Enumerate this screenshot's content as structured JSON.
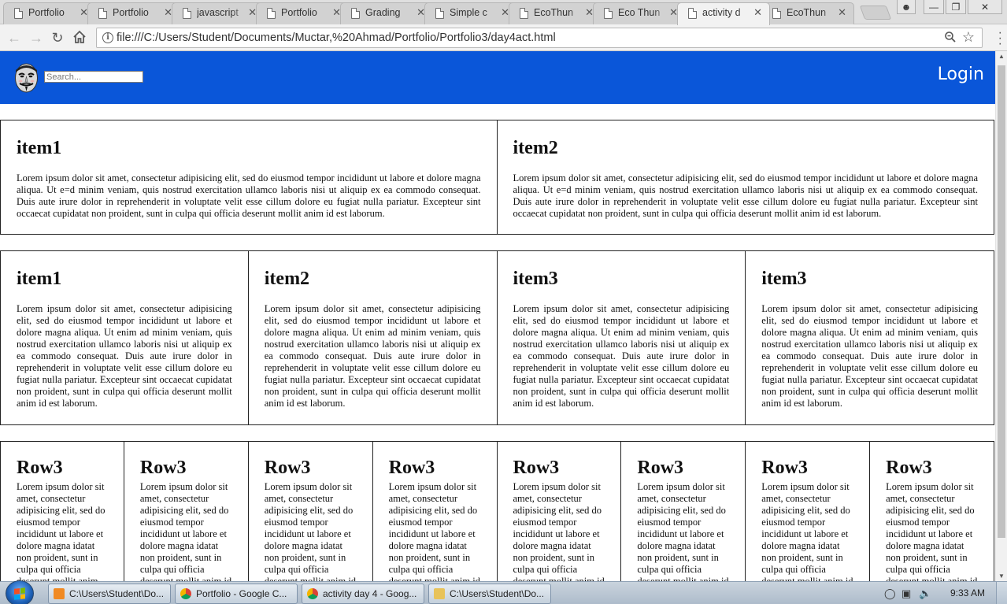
{
  "browser": {
    "tabs": [
      {
        "label": "Portfolio",
        "active": false
      },
      {
        "label": "Portfolio",
        "active": false
      },
      {
        "label": "javascript",
        "active": false
      },
      {
        "label": "Portfolio",
        "active": false
      },
      {
        "label": "Grading",
        "active": false
      },
      {
        "label": "Simple c",
        "active": false
      },
      {
        "label": "EcoThun",
        "active": false
      },
      {
        "label": "Eco Thun",
        "active": false
      },
      {
        "label": "activity d",
        "active": true
      },
      {
        "label": "EcoThun",
        "active": false
      }
    ],
    "tab_close_glyph": "✕",
    "address": "file:///C:/Users/Student/Documents/Muctar,%20Ahmad/Portfolio/Portfolio3/day4act.html"
  },
  "page": {
    "header": {
      "search_placeholder": "Search...",
      "login_label": "Login"
    },
    "row1": [
      {
        "title": "item1",
        "text": "Lorem ipsum dolor sit amet, consectetur adipisicing elit, sed do eiusmod tempor incididunt ut labore et dolore magna aliqua. Ut e=d minim veniam, quis nostrud exercitation ullamco laboris nisi ut aliquip ex ea commodo consequat. Duis aute irure dolor in reprehenderit in voluptate velit esse cillum dolore eu fugiat nulla pariatur. Excepteur sint occaecat cupidatat non proident, sunt in culpa qui officia deserunt mollit anim id est laborum."
      },
      {
        "title": "item2",
        "text": "Lorem ipsum dolor sit amet, consectetur adipisicing elit, sed do eiusmod tempor incididunt ut labore et dolore magna aliqua. Ut e=d minim veniam, quis nostrud exercitation ullamco laboris nisi ut aliquip ex ea commodo consequat. Duis aute irure dolor in reprehenderit in voluptate velit esse cillum dolore eu fugiat nulla pariatur. Excepteur sint occaecat cupidatat non proident, sunt in culpa qui officia deserunt mollit anim id est laborum."
      }
    ],
    "row2": [
      {
        "title": "item1",
        "text": "Lorem ipsum dolor sit amet, consectetur adipisicing elit, sed do eiusmod tempor incididunt ut labore et dolore magna aliqua. Ut enim ad minim veniam, quis nostrud exercitation ullamco laboris nisi ut aliquip ex ea commodo consequat. Duis aute irure dolor in reprehenderit in voluptate velit esse cillum dolore eu fugiat nulla pariatur. Excepteur sint occaecat cupidatat non proident, sunt in culpa qui officia deserunt mollit anim id est laborum."
      },
      {
        "title": "item2",
        "text": "Lorem ipsum dolor sit amet, consectetur adipisicing elit, sed do eiusmod tempor incididunt ut labore et dolore magna aliqua. Ut enim ad minim veniam, quis nostrud exercitation ullamco laboris nisi ut aliquip ex ea commodo consequat. Duis aute irure dolor in reprehenderit in voluptate velit esse cillum dolore eu fugiat nulla pariatur. Excepteur sint occaecat cupidatat non proident, sunt in culpa qui officia deserunt mollit anim id est laborum."
      },
      {
        "title": "item3",
        "text": "Lorem ipsum dolor sit amet, consectetur adipisicing elit, sed do eiusmod tempor incididunt ut labore et dolore magna aliqua. Ut enim ad minim veniam, quis nostrud exercitation ullamco laboris nisi ut aliquip ex ea commodo consequat. Duis aute irure dolor in reprehenderit in voluptate velit esse cillum dolore eu fugiat nulla pariatur. Excepteur sint occaecat cupidatat non proident, sunt in culpa qui officia deserunt mollit anim id est laborum."
      },
      {
        "title": "item3",
        "text": "Lorem ipsum dolor sit amet, consectetur adipisicing elit, sed do eiusmod tempor incididunt ut labore et dolore magna aliqua. Ut enim ad minim veniam, quis nostrud exercitation ullamco laboris nisi ut aliquip ex ea commodo consequat. Duis aute irure dolor in reprehenderit in voluptate velit esse cillum dolore eu fugiat nulla pariatur. Excepteur sint occaecat cupidatat non proident, sunt in culpa qui officia deserunt mollit anim id est laborum."
      }
    ],
    "row3": [
      {
        "title": "Row3",
        "text": "Lorem ipsum dolor sit amet, consectetur adipisicing elit, sed do eiusmod tempor incididunt ut labore et dolore magna idatat non proident, sunt in culpa qui officia deserunt mollit anim id est laborum."
      },
      {
        "title": "Row3",
        "text": "Lorem ipsum dolor sit amet, consectetur adipisicing elit, sed do eiusmod tempor incididunt ut labore et dolore magna idatat non proident, sunt in culpa qui officia deserunt mollit anim id est laborum."
      },
      {
        "title": "Row3",
        "text": "Lorem ipsum dolor sit amet, consectetur adipisicing elit, sed do eiusmod tempor incididunt ut labore et dolore magna idatat non proident, sunt in culpa qui officia deserunt mollit anim id est laborum."
      },
      {
        "title": "Row3",
        "text": "Lorem ipsum dolor sit amet, consectetur adipisicing elit, sed do eiusmod tempor incididunt ut labore et dolore magna idatat non proident, sunt in culpa qui officia deserunt mollit anim id est laborum."
      },
      {
        "title": "Row3",
        "text": "Lorem ipsum dolor sit amet, consectetur adipisicing elit, sed do eiusmod tempor incididunt ut labore et dolore magna idatat non proident, sunt in culpa qui officia deserunt mollit anim id est laborum."
      },
      {
        "title": "Row3",
        "text": "Lorem ipsum dolor sit amet, consectetur adipisicing elit, sed do eiusmod tempor incididunt ut labore et dolore magna idatat non proident, sunt in culpa qui officia deserunt mollit anim id est laborum."
      },
      {
        "title": "Row3",
        "text": "Lorem ipsum dolor sit amet, consectetur adipisicing elit, sed do eiusmod tempor incididunt ut labore et dolore magna idatat non proident, sunt in culpa qui officia deserunt mollit anim id est laborum."
      },
      {
        "title": "Row3",
        "text": "Lorem ipsum dolor sit amet, consectetur adipisicing elit, sed do eiusmod tempor incididunt ut labore et dolore magna idatat non proident, sunt in culpa qui officia deserunt mollit anim id est laborum."
      }
    ]
  },
  "taskbar": {
    "tasks": [
      {
        "label": "C:\\Users\\Student\\Do...",
        "icon": "sublime-text-icon"
      },
      {
        "label": "Portfolio - Google C...",
        "icon": "chrome-icon"
      },
      {
        "label": "activity day 4 - Goog...",
        "icon": "chrome-icon"
      },
      {
        "label": "C:\\Users\\Student\\Do...",
        "icon": "folder-icon"
      }
    ],
    "clock": "9:33 AM"
  },
  "colors": {
    "header_blue": "#0a56d9",
    "tab_active": "#f2f2f2",
    "tab_inactive": "#d2d2d2"
  }
}
